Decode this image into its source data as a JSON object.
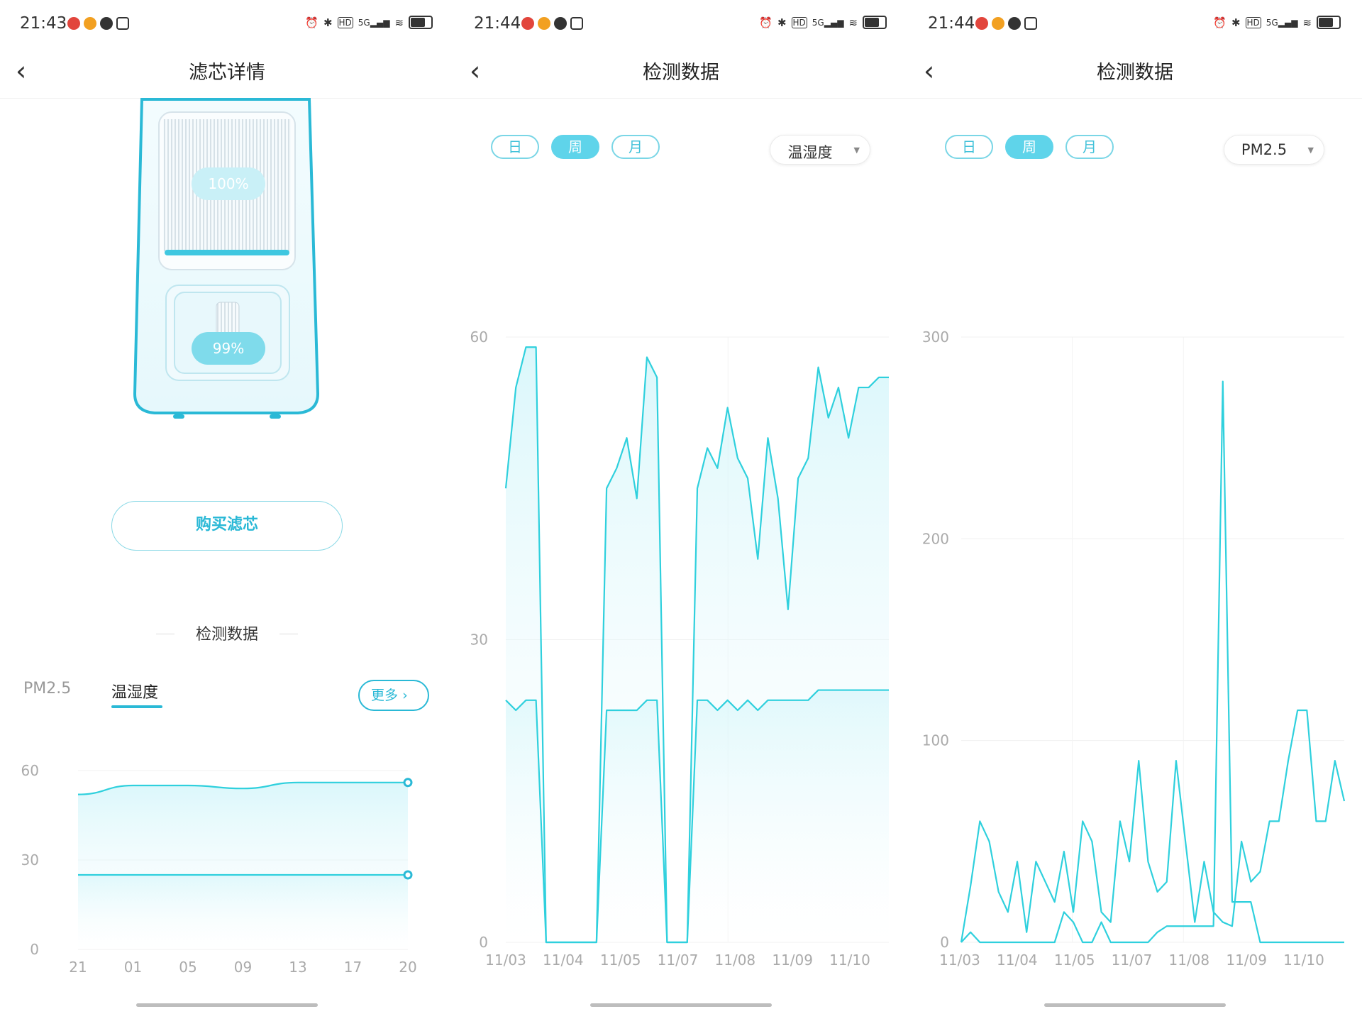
{
  "screen1": {
    "time": "21:43",
    "nav_title": "滤芯详情",
    "filter_top_pct": "100%",
    "filter_bottom_pct": "99%",
    "buy_label": "购买滤芯",
    "section_title": "检测数据",
    "tabs": [
      "PM2.5",
      "温湿度"
    ],
    "more_label": "更多",
    "chart_data": {
      "type": "area",
      "x": [
        "21",
        "01",
        "05",
        "09",
        "13",
        "17",
        "20"
      ],
      "yticks": [
        "0",
        "30",
        "60"
      ],
      "ylim": [
        0,
        60
      ],
      "series": [
        {
          "values": [
            52,
            55,
            55,
            54,
            56,
            56,
            56
          ]
        },
        {
          "values": [
            25,
            25,
            25,
            25,
            25,
            25,
            25
          ]
        }
      ]
    }
  },
  "screen2": {
    "time": "21:44",
    "nav_title": "检测数据",
    "periods": [
      "日",
      "周",
      "月"
    ],
    "active_period": "周",
    "dropdown_label": "温湿度",
    "chart_data": {
      "type": "area",
      "x": [
        "11/03",
        "11/04",
        "11/05",
        "11/07",
        "11/08",
        "11/09",
        "11/10"
      ],
      "yticks": [
        "0",
        "30",
        "60"
      ],
      "ylim": [
        0,
        60
      ],
      "series": [
        {
          "values": [
            45,
            55,
            59,
            59,
            0,
            0,
            0,
            0,
            0,
            0,
            45,
            47,
            50,
            44,
            58,
            56,
            0,
            0,
            0,
            45,
            49,
            47,
            53,
            48,
            46,
            38,
            50,
            44,
            33,
            46,
            48,
            57,
            52,
            55,
            50,
            55,
            55,
            56,
            56
          ]
        },
        {
          "values": [
            24,
            23,
            24,
            24,
            0,
            0,
            0,
            0,
            0,
            0,
            23,
            23,
            23,
            23,
            24,
            24,
            0,
            0,
            0,
            24,
            24,
            23,
            24,
            23,
            24,
            23,
            24,
            24,
            24,
            24,
            24,
            25,
            25,
            25,
            25,
            25,
            25,
            25,
            25
          ]
        }
      ]
    }
  },
  "screen3": {
    "time": "21:44",
    "nav_title": "检测数据",
    "periods": [
      "日",
      "周",
      "月"
    ],
    "active_period": "周",
    "dropdown_label": "PM2.5",
    "chart_data": {
      "type": "line",
      "x": [
        "11/03",
        "11/04",
        "11/05",
        "11/07",
        "11/08",
        "11/09",
        "11/10"
      ],
      "yticks": [
        "0",
        "100",
        "200",
        "300"
      ],
      "ylim": [
        0,
        300
      ],
      "series": [
        {
          "values": [
            0,
            28,
            60,
            50,
            25,
            15,
            40,
            5,
            40,
            30,
            20,
            45,
            15,
            60,
            50,
            15,
            10,
            60,
            40,
            90,
            40,
            25,
            30,
            90,
            50,
            10,
            40,
            15,
            10,
            8,
            50,
            30,
            35,
            60,
            60,
            90,
            115,
            115,
            60,
            60,
            90,
            70
          ]
        },
        {
          "values": [
            0,
            5,
            0,
            0,
            0,
            0,
            0,
            0,
            0,
            0,
            0,
            15,
            10,
            0,
            0,
            10,
            0,
            0,
            0,
            0,
            0,
            5,
            8,
            8,
            8,
            8,
            8,
            8,
            278,
            20,
            20,
            20,
            0,
            0,
            0,
            0,
            0,
            0,
            0,
            0,
            0,
            0
          ]
        }
      ]
    }
  },
  "colors": {
    "accent": "#2ab9d6",
    "line": "#2fd0dd",
    "fill": "#d8f6fa"
  }
}
